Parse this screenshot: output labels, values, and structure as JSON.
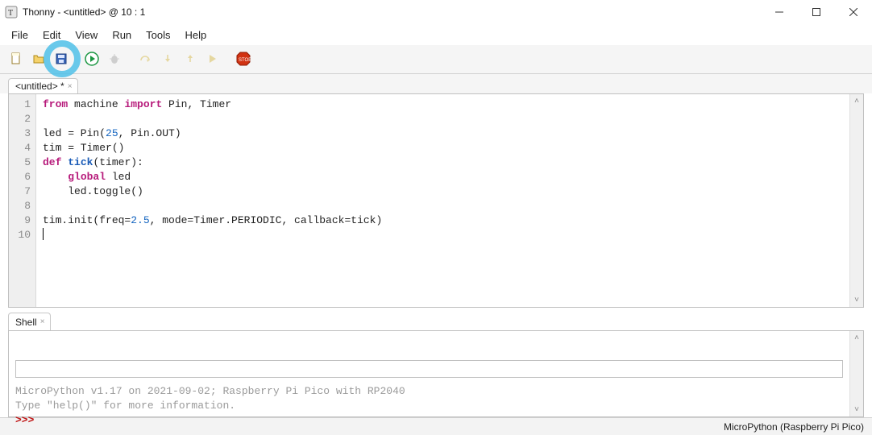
{
  "window": {
    "title": "Thonny  -  <untitled>  @  10 : 1",
    "app_icon": "thonny-logo"
  },
  "menu": [
    "File",
    "Edit",
    "View",
    "Run",
    "Tools",
    "Help"
  ],
  "toolbar": [
    {
      "id": "new-file-button",
      "icon": "file-new-icon"
    },
    {
      "id": "open-file-button",
      "icon": "folder-open-icon"
    },
    {
      "id": "save-file-button",
      "icon": "save-disk-icon",
      "highlighted": true
    },
    {
      "id": "run-button",
      "icon": "play-circle-icon"
    },
    {
      "id": "debug-button",
      "icon": "bug-icon",
      "disabled": true
    },
    {
      "id": "step-over-button",
      "icon": "step-over-icon",
      "disabled": true
    },
    {
      "id": "step-into-button",
      "icon": "step-into-icon",
      "disabled": true
    },
    {
      "id": "step-out-button",
      "icon": "step-out-icon",
      "disabled": true
    },
    {
      "id": "resume-button",
      "icon": "resume-icon",
      "disabled": true
    },
    {
      "id": "stop-button",
      "icon": "stop-sign-icon"
    }
  ],
  "editor": {
    "tab_label": "<untitled> *",
    "line_offset": 1,
    "lines": [
      {
        "t": [
          {
            "k": "kw",
            "s": "from"
          },
          {
            "k": "p",
            "s": " machine "
          },
          {
            "k": "kw",
            "s": "import"
          },
          {
            "k": "p",
            "s": " Pin, Timer"
          }
        ]
      },
      {
        "t": []
      },
      {
        "t": [
          {
            "k": "p",
            "s": "led = Pin("
          },
          {
            "k": "num",
            "s": "25"
          },
          {
            "k": "p",
            "s": ", Pin.OUT)"
          }
        ]
      },
      {
        "t": [
          {
            "k": "p",
            "s": "tim = Timer()"
          }
        ]
      },
      {
        "t": [
          {
            "k": "kw",
            "s": "def"
          },
          {
            "k": "p",
            "s": " "
          },
          {
            "k": "fn",
            "s": "tick"
          },
          {
            "k": "p",
            "s": "(timer):"
          }
        ]
      },
      {
        "t": [
          {
            "k": "p",
            "s": "    "
          },
          {
            "k": "kw",
            "s": "global"
          },
          {
            "k": "p",
            "s": " led"
          }
        ]
      },
      {
        "t": [
          {
            "k": "p",
            "s": "    led.toggle()"
          }
        ]
      },
      {
        "t": []
      },
      {
        "t": [
          {
            "k": "p",
            "s": "tim.init(freq="
          },
          {
            "k": "num",
            "s": "2.5"
          },
          {
            "k": "p",
            "s": ", mode=Timer.PERIODIC, callback=tick)"
          }
        ]
      },
      {
        "t": [],
        "cursor": true
      }
    ]
  },
  "shell": {
    "tab_label": "Shell",
    "line1": "MicroPython v1.17 on 2021-09-02; Raspberry Pi Pico with RP2040",
    "line2": "Type \"help()\" for more information.",
    "prompt": ">>>"
  },
  "status": {
    "interpreter": "MicroPython (Raspberry Pi Pico)"
  }
}
